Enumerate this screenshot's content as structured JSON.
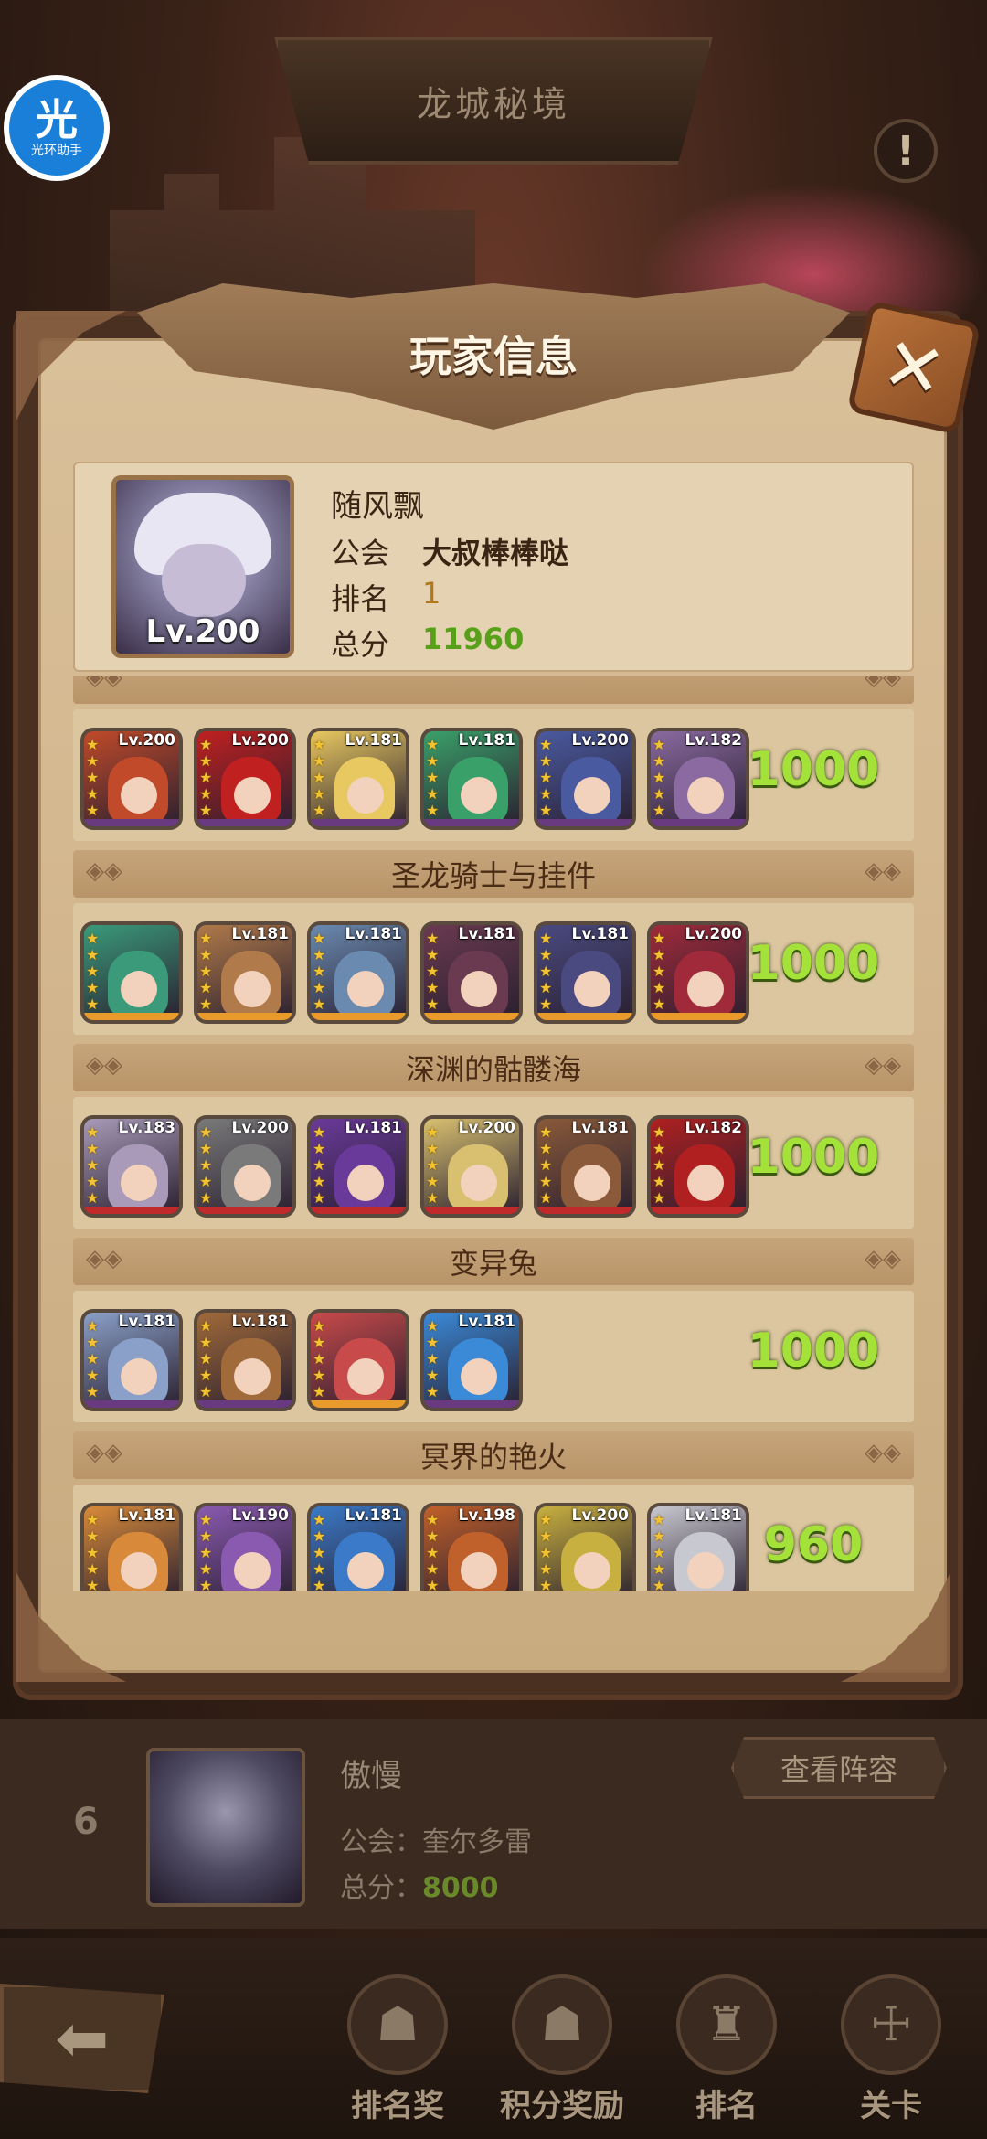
{
  "top": {
    "title": "龙城秘境",
    "helper_badge_big": "光",
    "helper_badge_small": "光环助手",
    "info_icon": "!"
  },
  "dialog": {
    "title": "玩家信息",
    "close_icon": "✕"
  },
  "player": {
    "name": "随风飘",
    "level": "Lv.200",
    "guild_label": "公会",
    "guild_value": "大叔棒棒哒",
    "rank_label": "排名",
    "rank_value": "1",
    "score_label": "总分",
    "score_value": "11960"
  },
  "teams": [
    {
      "name": "",
      "score": "1000",
      "heroes": [
        {
          "level": "Lv.200",
          "stars": 5,
          "color": "#c04a2a",
          "rarity": "#6a3a80"
        },
        {
          "level": "Lv.200",
          "stars": 5,
          "color": "#c02020",
          "rarity": "#6a3a80"
        },
        {
          "level": "Lv.181",
          "stars": 5,
          "color": "#e8c860",
          "rarity": "#6a3a80"
        },
        {
          "level": "Lv.181",
          "stars": 5,
          "color": "#3aa06a",
          "rarity": "#6a3a80"
        },
        {
          "level": "Lv.200",
          "stars": 5,
          "color": "#4a5aa0",
          "rarity": "#6a3a80"
        },
        {
          "level": "Lv.182",
          "stars": 5,
          "color": "#8a6aa0",
          "rarity": "#6a3a80"
        }
      ]
    },
    {
      "name": "圣龙骑士与挂件",
      "score": "1000",
      "heroes": [
        {
          "level": "",
          "stars": 5,
          "color": "#3a9a7a",
          "rarity": "#e89a2a"
        },
        {
          "level": "Lv.181",
          "stars": 5,
          "color": "#b07a4a",
          "rarity": "#e89a2a"
        },
        {
          "level": "Lv.181",
          "stars": 5,
          "color": "#6a8ab0",
          "rarity": "#e89a2a"
        },
        {
          "level": "Lv.181",
          "stars": 5,
          "color": "#6a3a50",
          "rarity": "#e89a2a"
        },
        {
          "level": "Lv.181",
          "stars": 5,
          "color": "#4a4a80",
          "rarity": "#e89a2a"
        },
        {
          "level": "Lv.200",
          "stars": 5,
          "color": "#a02a3a",
          "rarity": "#e89a2a"
        }
      ]
    },
    {
      "name": "深渊的骷髅海",
      "score": "1000",
      "heroes": [
        {
          "level": "Lv.183",
          "stars": 5,
          "color": "#a89ab8",
          "rarity": "#c02a2a"
        },
        {
          "level": "Lv.200",
          "stars": 5,
          "color": "#7a7a7a",
          "rarity": "#c02a2a"
        },
        {
          "level": "Lv.181",
          "stars": 5,
          "color": "#6a3a9a",
          "rarity": "#c02a2a"
        },
        {
          "level": "Lv.200",
          "stars": 5,
          "color": "#d8c070",
          "rarity": "#c02a2a"
        },
        {
          "level": "Lv.181",
          "stars": 5,
          "color": "#8a5a3a",
          "rarity": "#c02a2a"
        },
        {
          "level": "Lv.182",
          "stars": 5,
          "color": "#b02020",
          "rarity": "#c02a2a"
        }
      ]
    },
    {
      "name": "变异兔",
      "score": "1000",
      "heroes": [
        {
          "level": "Lv.181",
          "stars": 5,
          "color": "#8aa0c8",
          "rarity": "#6a3a80"
        },
        {
          "level": "Lv.181",
          "stars": 5,
          "color": "#a06a3a",
          "rarity": "#6a3a80"
        },
        {
          "level": "",
          "stars": 5,
          "color": "#c84a4a",
          "rarity": "#e89a2a"
        },
        {
          "level": "Lv.181",
          "stars": 5,
          "color": "#3a8ad8",
          "rarity": "#6a3a80"
        }
      ]
    },
    {
      "name": "冥界的艳火",
      "score": "960",
      "heroes": [
        {
          "level": "Lv.181",
          "stars": 5,
          "color": "#d88a3a",
          "rarity": "#e89a2a"
        },
        {
          "level": "Lv.190",
          "stars": 5,
          "color": "#8a5ab0",
          "rarity": "#6a3a80"
        },
        {
          "level": "Lv.181",
          "stars": 5,
          "color": "#3a7ac8",
          "rarity": "#e89a2a"
        },
        {
          "level": "Lv.198",
          "stars": 5,
          "color": "#c0602a",
          "rarity": "#c02a2a"
        },
        {
          "level": "Lv.200",
          "stars": 5,
          "color": "#c8b040",
          "rarity": "#c02a2a"
        },
        {
          "level": "Lv.181",
          "stars": 5,
          "color": "#c8c8d0",
          "rarity": "#6a3a80"
        }
      ]
    }
  ],
  "leaderboard_entry": {
    "rank": "6",
    "name": "傲慢",
    "guild_line": "公会：",
    "guild_value": "奎尔多雷",
    "score_line": "总分：",
    "score_value": "8000",
    "view_button": "查看阵容"
  },
  "nav": {
    "back_icon": "⬅",
    "items": [
      {
        "label": "排名奖",
        "icon": "trophy-icon",
        "glyph": "☗"
      },
      {
        "label": "积分奖励",
        "icon": "scroll-icon",
        "glyph": "☗"
      },
      {
        "label": "排名",
        "icon": "rank-icon",
        "glyph": "♜"
      },
      {
        "label": "关卡",
        "icon": "stage-icon",
        "glyph": "☩"
      }
    ]
  }
}
